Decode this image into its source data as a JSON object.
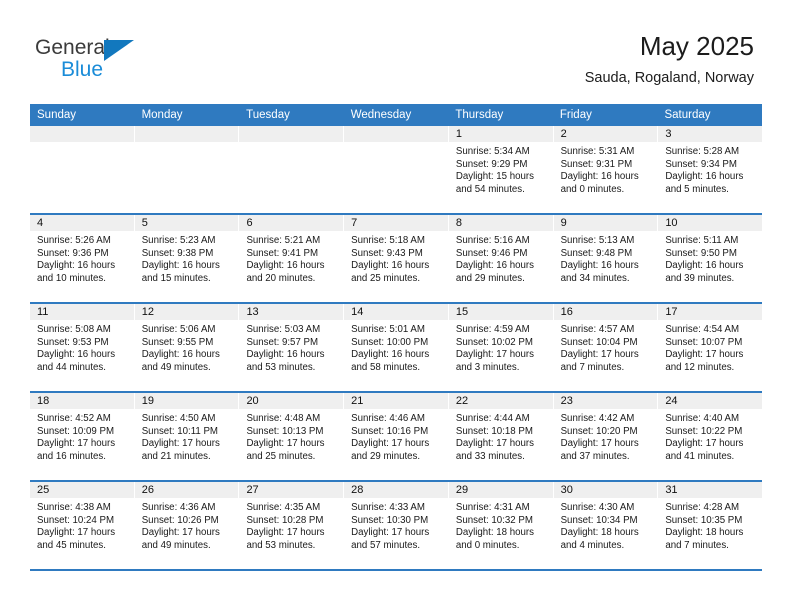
{
  "brand": {
    "name_top": "General",
    "name_bottom": "Blue",
    "accent_color": "#1278be"
  },
  "header": {
    "title": "May 2025",
    "subtitle": "Sauda, Rogaland, Norway",
    "header_bg_color": "#2f7ac0",
    "day_band_color": "#efefef"
  },
  "weekdays": [
    "Sunday",
    "Monday",
    "Tuesday",
    "Wednesday",
    "Thursday",
    "Friday",
    "Saturday"
  ],
  "weeks": [
    [
      {
        "day": "",
        "sunrise": "",
        "sunset": "",
        "daylight_line1": "",
        "daylight_line2": ""
      },
      {
        "day": "",
        "sunrise": "",
        "sunset": "",
        "daylight_line1": "",
        "daylight_line2": ""
      },
      {
        "day": "",
        "sunrise": "",
        "sunset": "",
        "daylight_line1": "",
        "daylight_line2": ""
      },
      {
        "day": "",
        "sunrise": "",
        "sunset": "",
        "daylight_line1": "",
        "daylight_line2": ""
      },
      {
        "day": "1",
        "sunrise": "Sunrise: 5:34 AM",
        "sunset": "Sunset: 9:29 PM",
        "daylight_line1": "Daylight: 15 hours",
        "daylight_line2": "and 54 minutes."
      },
      {
        "day": "2",
        "sunrise": "Sunrise: 5:31 AM",
        "sunset": "Sunset: 9:31 PM",
        "daylight_line1": "Daylight: 16 hours",
        "daylight_line2": "and 0 minutes."
      },
      {
        "day": "3",
        "sunrise": "Sunrise: 5:28 AM",
        "sunset": "Sunset: 9:34 PM",
        "daylight_line1": "Daylight: 16 hours",
        "daylight_line2": "and 5 minutes."
      }
    ],
    [
      {
        "day": "4",
        "sunrise": "Sunrise: 5:26 AM",
        "sunset": "Sunset: 9:36 PM",
        "daylight_line1": "Daylight: 16 hours",
        "daylight_line2": "and 10 minutes."
      },
      {
        "day": "5",
        "sunrise": "Sunrise: 5:23 AM",
        "sunset": "Sunset: 9:38 PM",
        "daylight_line1": "Daylight: 16 hours",
        "daylight_line2": "and 15 minutes."
      },
      {
        "day": "6",
        "sunrise": "Sunrise: 5:21 AM",
        "sunset": "Sunset: 9:41 PM",
        "daylight_line1": "Daylight: 16 hours",
        "daylight_line2": "and 20 minutes."
      },
      {
        "day": "7",
        "sunrise": "Sunrise: 5:18 AM",
        "sunset": "Sunset: 9:43 PM",
        "daylight_line1": "Daylight: 16 hours",
        "daylight_line2": "and 25 minutes."
      },
      {
        "day": "8",
        "sunrise": "Sunrise: 5:16 AM",
        "sunset": "Sunset: 9:46 PM",
        "daylight_line1": "Daylight: 16 hours",
        "daylight_line2": "and 29 minutes."
      },
      {
        "day": "9",
        "sunrise": "Sunrise: 5:13 AM",
        "sunset": "Sunset: 9:48 PM",
        "daylight_line1": "Daylight: 16 hours",
        "daylight_line2": "and 34 minutes."
      },
      {
        "day": "10",
        "sunrise": "Sunrise: 5:11 AM",
        "sunset": "Sunset: 9:50 PM",
        "daylight_line1": "Daylight: 16 hours",
        "daylight_line2": "and 39 minutes."
      }
    ],
    [
      {
        "day": "11",
        "sunrise": "Sunrise: 5:08 AM",
        "sunset": "Sunset: 9:53 PM",
        "daylight_line1": "Daylight: 16 hours",
        "daylight_line2": "and 44 minutes."
      },
      {
        "day": "12",
        "sunrise": "Sunrise: 5:06 AM",
        "sunset": "Sunset: 9:55 PM",
        "daylight_line1": "Daylight: 16 hours",
        "daylight_line2": "and 49 minutes."
      },
      {
        "day": "13",
        "sunrise": "Sunrise: 5:03 AM",
        "sunset": "Sunset: 9:57 PM",
        "daylight_line1": "Daylight: 16 hours",
        "daylight_line2": "and 53 minutes."
      },
      {
        "day": "14",
        "sunrise": "Sunrise: 5:01 AM",
        "sunset": "Sunset: 10:00 PM",
        "daylight_line1": "Daylight: 16 hours",
        "daylight_line2": "and 58 minutes."
      },
      {
        "day": "15",
        "sunrise": "Sunrise: 4:59 AM",
        "sunset": "Sunset: 10:02 PM",
        "daylight_line1": "Daylight: 17 hours",
        "daylight_line2": "and 3 minutes."
      },
      {
        "day": "16",
        "sunrise": "Sunrise: 4:57 AM",
        "sunset": "Sunset: 10:04 PM",
        "daylight_line1": "Daylight: 17 hours",
        "daylight_line2": "and 7 minutes."
      },
      {
        "day": "17",
        "sunrise": "Sunrise: 4:54 AM",
        "sunset": "Sunset: 10:07 PM",
        "daylight_line1": "Daylight: 17 hours",
        "daylight_line2": "and 12 minutes."
      }
    ],
    [
      {
        "day": "18",
        "sunrise": "Sunrise: 4:52 AM",
        "sunset": "Sunset: 10:09 PM",
        "daylight_line1": "Daylight: 17 hours",
        "daylight_line2": "and 16 minutes."
      },
      {
        "day": "19",
        "sunrise": "Sunrise: 4:50 AM",
        "sunset": "Sunset: 10:11 PM",
        "daylight_line1": "Daylight: 17 hours",
        "daylight_line2": "and 21 minutes."
      },
      {
        "day": "20",
        "sunrise": "Sunrise: 4:48 AM",
        "sunset": "Sunset: 10:13 PM",
        "daylight_line1": "Daylight: 17 hours",
        "daylight_line2": "and 25 minutes."
      },
      {
        "day": "21",
        "sunrise": "Sunrise: 4:46 AM",
        "sunset": "Sunset: 10:16 PM",
        "daylight_line1": "Daylight: 17 hours",
        "daylight_line2": "and 29 minutes."
      },
      {
        "day": "22",
        "sunrise": "Sunrise: 4:44 AM",
        "sunset": "Sunset: 10:18 PM",
        "daylight_line1": "Daylight: 17 hours",
        "daylight_line2": "and 33 minutes."
      },
      {
        "day": "23",
        "sunrise": "Sunrise: 4:42 AM",
        "sunset": "Sunset: 10:20 PM",
        "daylight_line1": "Daylight: 17 hours",
        "daylight_line2": "and 37 minutes."
      },
      {
        "day": "24",
        "sunrise": "Sunrise: 4:40 AM",
        "sunset": "Sunset: 10:22 PM",
        "daylight_line1": "Daylight: 17 hours",
        "daylight_line2": "and 41 minutes."
      }
    ],
    [
      {
        "day": "25",
        "sunrise": "Sunrise: 4:38 AM",
        "sunset": "Sunset: 10:24 PM",
        "daylight_line1": "Daylight: 17 hours",
        "daylight_line2": "and 45 minutes."
      },
      {
        "day": "26",
        "sunrise": "Sunrise: 4:36 AM",
        "sunset": "Sunset: 10:26 PM",
        "daylight_line1": "Daylight: 17 hours",
        "daylight_line2": "and 49 minutes."
      },
      {
        "day": "27",
        "sunrise": "Sunrise: 4:35 AM",
        "sunset": "Sunset: 10:28 PM",
        "daylight_line1": "Daylight: 17 hours",
        "daylight_line2": "and 53 minutes."
      },
      {
        "day": "28",
        "sunrise": "Sunrise: 4:33 AM",
        "sunset": "Sunset: 10:30 PM",
        "daylight_line1": "Daylight: 17 hours",
        "daylight_line2": "and 57 minutes."
      },
      {
        "day": "29",
        "sunrise": "Sunrise: 4:31 AM",
        "sunset": "Sunset: 10:32 PM",
        "daylight_line1": "Daylight: 18 hours",
        "daylight_line2": "and 0 minutes."
      },
      {
        "day": "30",
        "sunrise": "Sunrise: 4:30 AM",
        "sunset": "Sunset: 10:34 PM",
        "daylight_line1": "Daylight: 18 hours",
        "daylight_line2": "and 4 minutes."
      },
      {
        "day": "31",
        "sunrise": "Sunrise: 4:28 AM",
        "sunset": "Sunset: 10:35 PM",
        "daylight_line1": "Daylight: 18 hours",
        "daylight_line2": "and 7 minutes."
      }
    ]
  ]
}
